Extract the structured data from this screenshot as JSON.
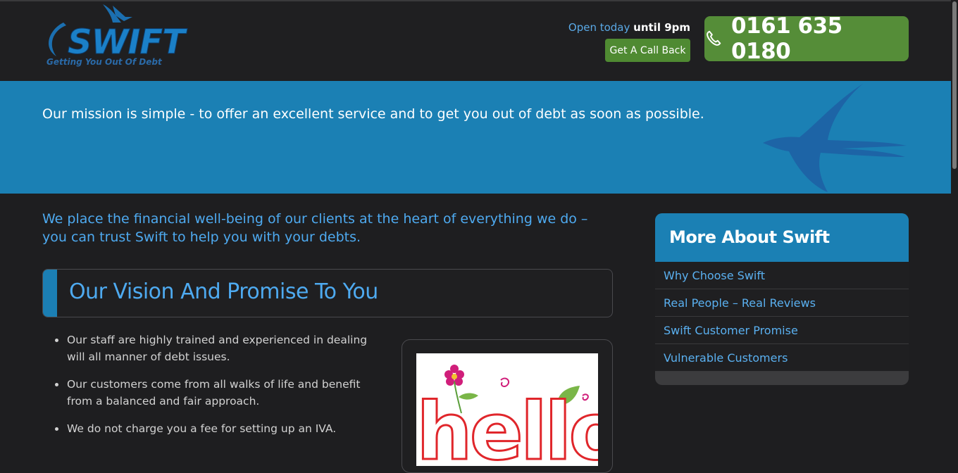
{
  "header": {
    "logo": {
      "brand": "SWIFT",
      "tagline": "Getting You Out Of Debt"
    },
    "open_prefix": "Open today",
    "open_suffix": "until 9pm",
    "callback_label": "Get A Call Back",
    "phone_icon": "phone-icon",
    "phone_number": "0161 635 0180"
  },
  "hero": {
    "mission": "Our mission is simple - to offer an excellent service and to get you out of debt as soon as possible."
  },
  "main": {
    "intro": "We place the financial well-being of our clients at the heart of everything we do – you can trust Swift to help you with your debts.",
    "vision_title": "Our Vision And Promise To You",
    "points": [
      "Our staff are highly trained and experienced in dealing will all manner of debt issues.",
      "Our customers come from all walks of life and benefit from a balanced and fair approach.",
      "We do not charge you a fee for setting up an IVA."
    ],
    "image_text": "hello"
  },
  "sidebar": {
    "title": "More About Swift",
    "items": [
      {
        "label": "Why Choose Swift"
      },
      {
        "label": "Real People – Real Reviews"
      },
      {
        "label": "Swift Customer Promise"
      },
      {
        "label": "Vulnerable Customers"
      }
    ]
  },
  "colors": {
    "accent_blue": "#1b80b4",
    "link_blue": "#4eaaf0",
    "cta_green": "#558d38",
    "background": "#1e1e20"
  }
}
